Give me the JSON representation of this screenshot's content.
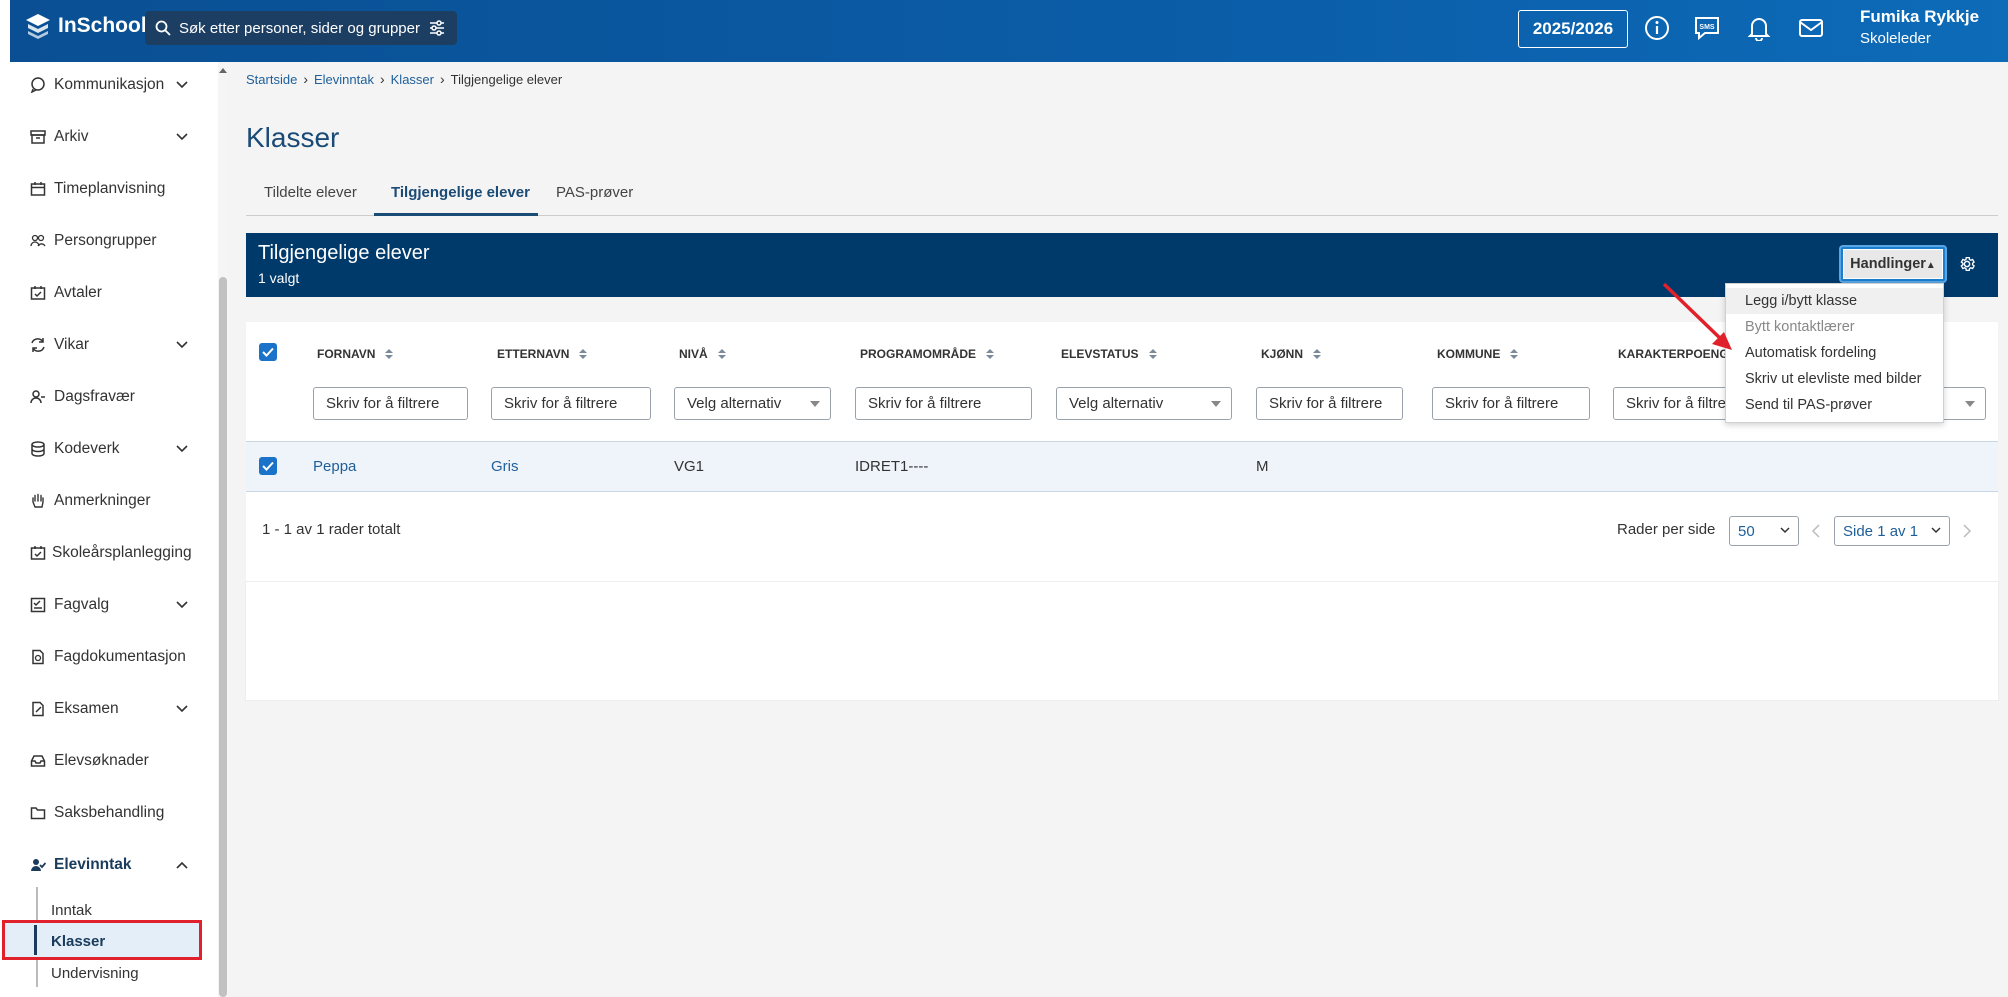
{
  "app": {
    "name": "InSchool"
  },
  "topbar": {
    "search_placeholder": "Søk etter personer, sider og grupper",
    "school_year": "2025/2026",
    "user_name": "Fumika Rykkje",
    "user_role": "Skoleleder",
    "icons": [
      "info-icon",
      "sms-icon",
      "bell-icon",
      "mail-icon"
    ]
  },
  "sidebar": {
    "items": [
      {
        "label": "Kommunikasjon",
        "icon": "chat-bubble-icon",
        "expandable": true
      },
      {
        "label": "Arkiv",
        "icon": "archive-icon",
        "expandable": true
      },
      {
        "label": "Timeplanvisning",
        "icon": "calendar-icon",
        "expandable": false
      },
      {
        "label": "Persongrupper",
        "icon": "people-icon",
        "expandable": false
      },
      {
        "label": "Avtaler",
        "icon": "calendar-check-icon",
        "expandable": false
      },
      {
        "label": "Vikar",
        "icon": "swap-icon",
        "expandable": true
      },
      {
        "label": "Dagsfravær",
        "icon": "person-minus-icon",
        "expandable": false
      },
      {
        "label": "Kodeverk",
        "icon": "database-icon",
        "expandable": true
      },
      {
        "label": "Anmerkninger",
        "icon": "hand-icon",
        "expandable": false
      },
      {
        "label": "Skoleårsplanlegging",
        "icon": "calendar-check-icon",
        "expandable": false
      },
      {
        "label": "Fagvalg",
        "icon": "checkbox-list-icon",
        "expandable": true
      },
      {
        "label": "Fagdokumentasjon",
        "icon": "document-icon",
        "expandable": false
      },
      {
        "label": "Eksamen",
        "icon": "edit-document-icon",
        "expandable": true
      },
      {
        "label": "Elevsøknader",
        "icon": "inbox-icon",
        "expandable": false
      },
      {
        "label": "Saksbehandling",
        "icon": "folder-icon",
        "expandable": false
      },
      {
        "label": "Elevinntak",
        "icon": "person-check-icon",
        "expandable": true,
        "expanded": true
      }
    ],
    "subitems": [
      "Inntak",
      "Klasser",
      "Undervisning"
    ],
    "active_subitem": "Klasser"
  },
  "breadcrumb": [
    "Startside",
    "Elevinntak",
    "Klasser",
    "Tilgjengelige elever"
  ],
  "page_title": "Klasser",
  "tabs": [
    "Tildelte elever",
    "Tilgjengelige elever",
    "PAS-prøver"
  ],
  "active_tab": "Tilgjengelige elever",
  "panel": {
    "title": "Tilgjengelige elever",
    "subtitle": "1 valgt",
    "actions_button": "Handlinger"
  },
  "table": {
    "columns": [
      "FORNAVN",
      "ETTERNAVN",
      "NIVÅ",
      "PROGRAMOMRÅDE",
      "ELEVSTATUS",
      "KJØNN",
      "KOMMUNE",
      "KARAKTERPOENGSUM"
    ],
    "filters": [
      "Skriv for å filtrere",
      "Skriv for å filtrere",
      "Velg alternativ",
      "Skriv for å filtrere",
      "Velg alternativ",
      "Skriv for å filtrere",
      "Skriv for å filtrere",
      "Skriv for å filtrere"
    ],
    "rows": [
      {
        "fornavn": "Peppa",
        "etternavn": "Gris",
        "niva": "VG1",
        "programomrade": "IDRET1----",
        "elevstatus": "",
        "kjonn": "M",
        "kommune": "",
        "karakterpoengsum": "",
        "selected": true
      }
    ],
    "footer_count": "1 - 1 av 1 rader totalt",
    "rows_per_page_label": "Rader per side",
    "rows_per_page": "50",
    "page_select": "Side 1 av 1"
  },
  "actions_menu": {
    "items": [
      {
        "label": "Legg i/bytt klasse",
        "disabled": false
      },
      {
        "label": "Bytt kontaktlærer",
        "disabled": true
      },
      {
        "label": "Automatisk fordeling",
        "disabled": false
      },
      {
        "label": "Skriv ut elevliste med bilder",
        "disabled": false
      },
      {
        "label": "Send til PAS-prøver",
        "disabled": false
      }
    ]
  },
  "colors": {
    "topbar": "#0b5da8",
    "panel_header": "#003a6b",
    "link": "#1f5f99",
    "highlight": "#e0202a"
  }
}
